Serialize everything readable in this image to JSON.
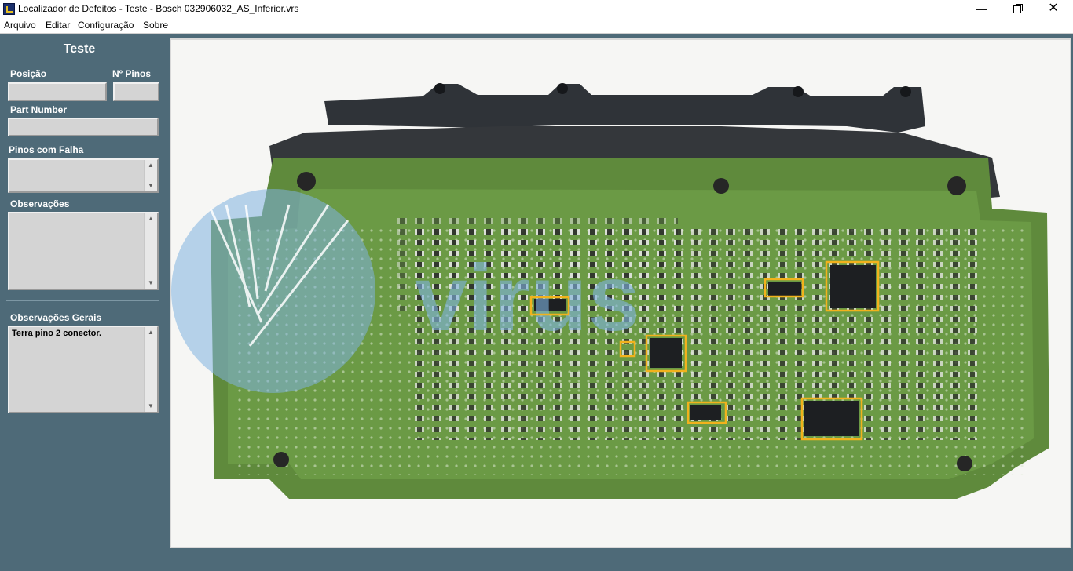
{
  "window": {
    "title": "Localizador de Defeitos - Teste - Bosch 032906032_AS_Inferior.vrs",
    "app_icon": "app-logo-icon",
    "minimize": "—",
    "maximize_icon": "restore-icon",
    "close": "✕"
  },
  "menu": [
    "Arquivo",
    "Editar",
    "Configuração",
    "Sobre"
  ],
  "panel": {
    "title": "Teste",
    "position_label": "Posição",
    "position_value": "",
    "pins_label": "Nº Pinos",
    "pins_value": "",
    "part_number_label": "Part Number",
    "part_number_value": "",
    "failed_pins_label": "Pinos com Falha",
    "failed_pins_value": "",
    "observations_label": "Observações",
    "observations_value": "",
    "general_observations_label": "Observações Gerais",
    "general_observations_value": "Terra pino 2 conector."
  },
  "viewer": {
    "image_subject": "pcb-board-photo",
    "highlight_color": "#f2b21c",
    "board_color": "#5f8a3c",
    "highlight_count": 8
  },
  "colors": {
    "panel_bg": "#4e6a78",
    "field_bg": "#d4d4d4",
    "title_bar": "#ffffff"
  }
}
